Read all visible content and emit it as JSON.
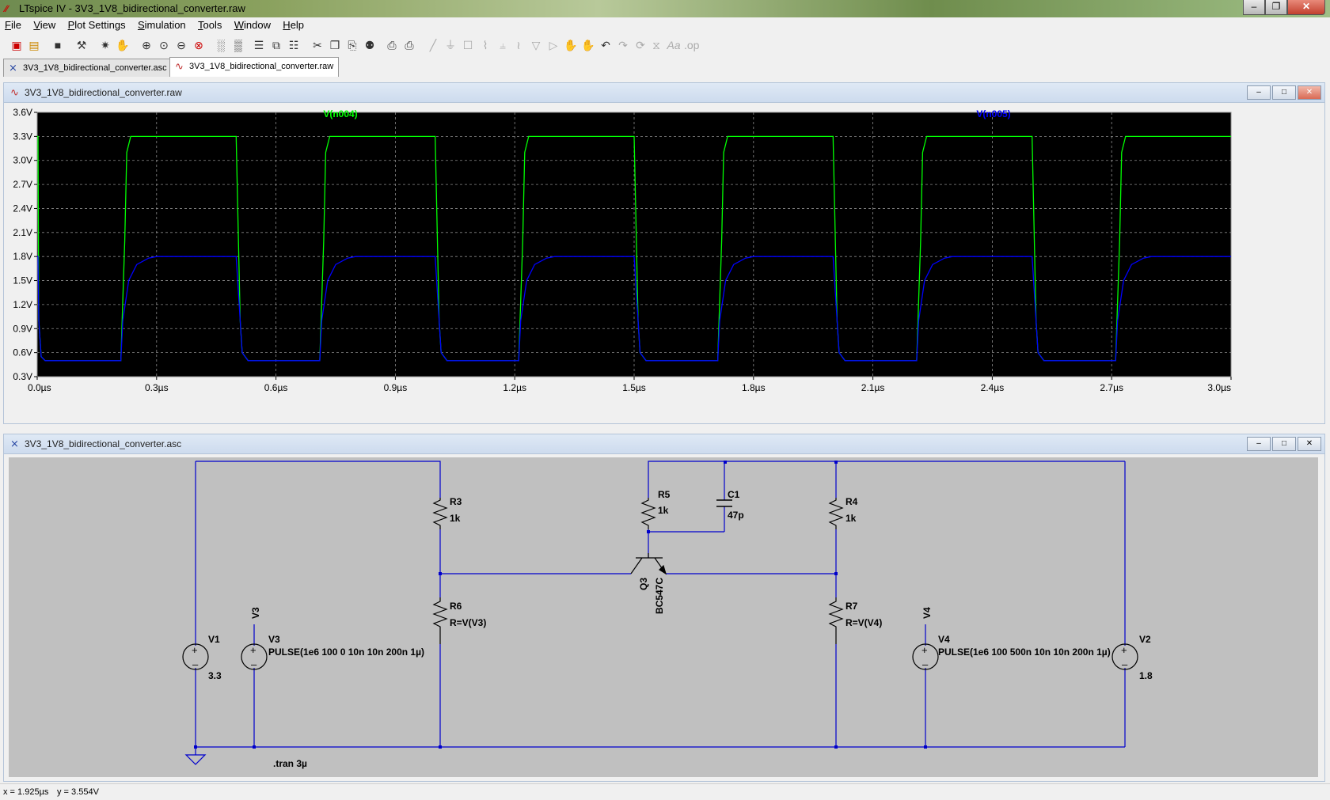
{
  "window": {
    "title": "LTspice IV - 3V3_1V8_bidirectional_converter.raw"
  },
  "menu": [
    "File",
    "View",
    "Plot Settings",
    "Simulation",
    "Tools",
    "Window",
    "Help"
  ],
  "toolbar_icons": [
    "new-schematic-icon",
    "open-icon",
    "save-icon",
    "control-panel-icon",
    "run-icon",
    "pan-hand-icon",
    "zoom-in-icon",
    "zoom-rect-icon",
    "zoom-out-icon",
    "zoom-cancel-icon",
    "autorange-icon",
    "zoom-fit-icon",
    "tile-horizontal-icon",
    "cascade-icon",
    "tile-vertical-icon",
    "cut-icon",
    "copy-icon",
    "paste-icon",
    "find-icon",
    "print-preview-icon",
    "print-icon",
    "wire-icon",
    "ground-icon",
    "label-icon",
    "resistor-icon",
    "capacitor-icon",
    "inductor-icon",
    "diode-icon",
    "component-icon",
    "move-icon",
    "drag-icon",
    "undo-icon",
    "redo-icon",
    "rotate-icon",
    "mirror-icon",
    "text-icon",
    "spice-directive-icon"
  ],
  "tabs": [
    {
      "label": "3V3_1V8_bidirectional_converter.asc",
      "active": false
    },
    {
      "label": "3V3_1V8_bidirectional_converter.raw",
      "active": true
    }
  ],
  "plot_window": {
    "title": "3V3_1V8_bidirectional_converter.raw",
    "trace_labels": [
      {
        "text": "V(n004)",
        "color": "#00ff00"
      },
      {
        "text": "V(n005)",
        "color": "#0000ff"
      }
    ]
  },
  "schematic_window": {
    "title": "3V3_1V8_bidirectional_converter.asc",
    "labels": {
      "r3_name": "R3",
      "r3_val": "1k",
      "r5_name": "R5",
      "r5_val": "1k",
      "c1_name": "C1",
      "c1_val": "47p",
      "r4_name": "R4",
      "r4_val": "1k",
      "r6_name": "R6",
      "r6_val": "R=V(V3)",
      "r7_name": "R7",
      "r7_val": "R=V(V4)",
      "q3_name": "Q3",
      "q3_val": "BC547C",
      "v1_name": "V1",
      "v1_val": "3.3",
      "v3_net": "V3",
      "v3_name": "V3",
      "v3_val": "PULSE(1e6 100 0 10n 10n 200n 1µ)",
      "v4_net": "V4",
      "v4_name": "V4",
      "v4_val": "PULSE(1e6 100 500n 10n 10n 200n 1µ)",
      "v2_name": "V2",
      "v2_val": "1.8",
      "directive": ".tran 3µ"
    }
  },
  "status": {
    "x": "x = 1.925µs",
    "y": "y = 3.554V"
  },
  "colors": {
    "plot_bg": "#000000",
    "grid": "#8a8a8a",
    "trace1": "#00ff00",
    "trace2": "#0000ff",
    "wire": "#0000cc",
    "schematic_bg": "#c0c0c0"
  },
  "chart_data": {
    "type": "line",
    "xlabel": "",
    "ylabel": "",
    "xlim": [
      0,
      3.0
    ],
    "ylim": [
      0.3,
      3.6
    ],
    "x_ticks": [
      "0.0µs",
      "0.3µs",
      "0.6µs",
      "0.9µs",
      "1.2µs",
      "1.5µs",
      "1.8µs",
      "2.1µs",
      "2.4µs",
      "2.7µs",
      "3.0µs"
    ],
    "x_tick_values": [
      0,
      0.3,
      0.6,
      0.9,
      1.2,
      1.5,
      1.8,
      2.1,
      2.4,
      2.7,
      3.0
    ],
    "y_ticks": [
      "3.6V",
      "3.3V",
      "3.0V",
      "2.7V",
      "2.4V",
      "2.1V",
      "1.8V",
      "1.5V",
      "1.2V",
      "0.9V",
      "0.6V",
      "0.3V"
    ],
    "y_tick_values": [
      3.6,
      3.3,
      3.0,
      2.7,
      2.4,
      2.1,
      1.8,
      1.5,
      1.2,
      0.9,
      0.6,
      0.3
    ],
    "grid": true,
    "series": [
      {
        "name": "V(n004)",
        "color": "#00ff00",
        "x": [
          0,
          0.002,
          0.004,
          0.01,
          0.02,
          0.21,
          0.22,
          0.225,
          0.235,
          0.5,
          0.51,
          0.515,
          0.53,
          0.71,
          0.72,
          0.725,
          0.735,
          1.0,
          1.01,
          1.015,
          1.03,
          1.21,
          1.22,
          1.225,
          1.235,
          1.5,
          1.51,
          1.515,
          1.53,
          1.71,
          1.72,
          1.725,
          1.735,
          2.0,
          2.01,
          2.015,
          2.03,
          2.21,
          2.22,
          2.225,
          2.235,
          2.5,
          2.51,
          2.515,
          2.53,
          2.71,
          2.72,
          2.725,
          2.735,
          3.0
        ],
        "y": [
          3.3,
          3.3,
          1.0,
          0.55,
          0.5,
          0.5,
          2.0,
          3.1,
          3.3,
          3.3,
          1.0,
          0.6,
          0.5,
          0.5,
          2.0,
          3.1,
          3.3,
          3.3,
          1.0,
          0.6,
          0.5,
          0.5,
          2.0,
          3.1,
          3.3,
          3.3,
          1.0,
          0.6,
          0.5,
          0.5,
          2.0,
          3.1,
          3.3,
          3.3,
          1.0,
          0.6,
          0.5,
          0.5,
          2.0,
          3.1,
          3.3,
          3.3,
          1.0,
          0.6,
          0.5,
          0.5,
          2.0,
          3.1,
          3.3,
          3.3
        ]
      },
      {
        "name": "V(n005)",
        "color": "#0000ff",
        "x": [
          0,
          0.002,
          0.004,
          0.01,
          0.02,
          0.21,
          0.215,
          0.23,
          0.25,
          0.28,
          0.3,
          0.5,
          0.51,
          0.515,
          0.53,
          0.71,
          0.715,
          0.73,
          0.75,
          0.78,
          0.8,
          1.0,
          1.01,
          1.015,
          1.03,
          1.21,
          1.215,
          1.23,
          1.25,
          1.28,
          1.3,
          1.5,
          1.51,
          1.515,
          1.53,
          1.71,
          1.715,
          1.73,
          1.75,
          1.78,
          1.8,
          2.0,
          2.01,
          2.015,
          2.03,
          2.21,
          2.215,
          2.23,
          2.25,
          2.28,
          2.3,
          2.5,
          2.51,
          2.515,
          2.53,
          2.71,
          2.715,
          2.73,
          2.75,
          2.78,
          2.8,
          3.0
        ],
        "y": [
          1.8,
          1.8,
          1.0,
          0.55,
          0.5,
          0.5,
          1.0,
          1.5,
          1.7,
          1.78,
          1.8,
          1.8,
          1.0,
          0.6,
          0.5,
          0.5,
          1.0,
          1.5,
          1.7,
          1.78,
          1.8,
          1.8,
          1.0,
          0.6,
          0.5,
          0.5,
          1.0,
          1.5,
          1.7,
          1.78,
          1.8,
          1.8,
          1.0,
          0.6,
          0.5,
          0.5,
          1.0,
          1.5,
          1.7,
          1.78,
          1.8,
          1.8,
          1.0,
          0.6,
          0.5,
          0.5,
          1.0,
          1.5,
          1.7,
          1.78,
          1.8,
          1.8,
          1.0,
          0.6,
          0.5,
          0.5,
          1.0,
          1.5,
          1.7,
          1.78,
          1.8,
          1.8
        ]
      }
    ]
  }
}
